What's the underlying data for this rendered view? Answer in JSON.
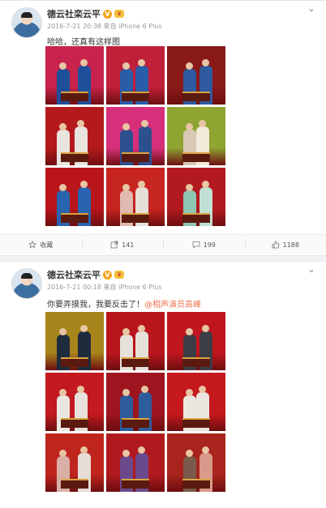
{
  "posts": [
    {
      "username": "德云社栾云平",
      "meta": "2016-7-21 20:38 来自 iPhone 6 Plus",
      "text": "哈哈，还真有这样图",
      "mention": "",
      "actions": {
        "favorite": "收藏",
        "repost": "141",
        "comment": "199",
        "like": "1188"
      },
      "photos": [
        {
          "bg": "#c8234c",
          "c1": "#1f4f9a",
          "c2": "#1f4f9a"
        },
        {
          "bg": "#c0203a",
          "c1": "#2a5ca8",
          "c2": "#2a5ca8"
        },
        {
          "bg": "#8a1a18",
          "c1": "#2e5aa0",
          "c2": "#2e5aa0"
        },
        {
          "bg": "#b41a1c",
          "c1": "#e9e4de",
          "c2": "#e9e4de"
        },
        {
          "bg": "#d6307a",
          "c1": "#2d4f8e",
          "c2": "#2d4f8e"
        },
        {
          "bg": "#8ea532",
          "c1": "#d8c8b4",
          "c2": "#f2e9da"
        },
        {
          "bg": "#b9151a",
          "c1": "#2a64b0",
          "c2": "#2a64b0"
        },
        {
          "bg": "#c62521",
          "c1": "#e0b9b0",
          "c2": "#e6dfda"
        },
        {
          "bg": "#b31a20",
          "c1": "#8ec6b6",
          "c2": "#bfe0d3"
        }
      ]
    },
    {
      "username": "德云社栾云平",
      "meta": "2016-7-21 00:18 来自 iPhone 6 Plus",
      "text": "你要弄摸我，我要反击了！",
      "mention": "@相声演员高峰",
      "actions": {
        "favorite": "",
        "repost": "",
        "comment": "",
        "like": ""
      },
      "photos": [
        {
          "bg": "#a8841c",
          "c1": "#1d2b3d",
          "c2": "#1d2b3d"
        },
        {
          "bg": "#b8161c",
          "c1": "#e5e0da",
          "c2": "#e5e0da"
        },
        {
          "bg": "#c0161d",
          "c1": "#3d3d46",
          "c2": "#3d3d46"
        },
        {
          "bg": "#c21a1f",
          "c1": "#ebe6e0",
          "c2": "#e8e2dc"
        },
        {
          "bg": "#9e1520",
          "c1": "#2d5c9c",
          "c2": "#2d5c9c"
        },
        {
          "bg": "#c5191d",
          "c1": "#ece6e0",
          "c2": "#ece6e0"
        },
        {
          "bg": "#c0251d",
          "c1": "#d8b0a6",
          "c2": "#e6ded6"
        },
        {
          "bg": "#b01a1e",
          "c1": "#6a4a8c",
          "c2": "#6a4a8c"
        },
        {
          "bg": "#a8241c",
          "c1": "#7a5a4a",
          "c2": "#d89a8a"
        }
      ]
    }
  ]
}
